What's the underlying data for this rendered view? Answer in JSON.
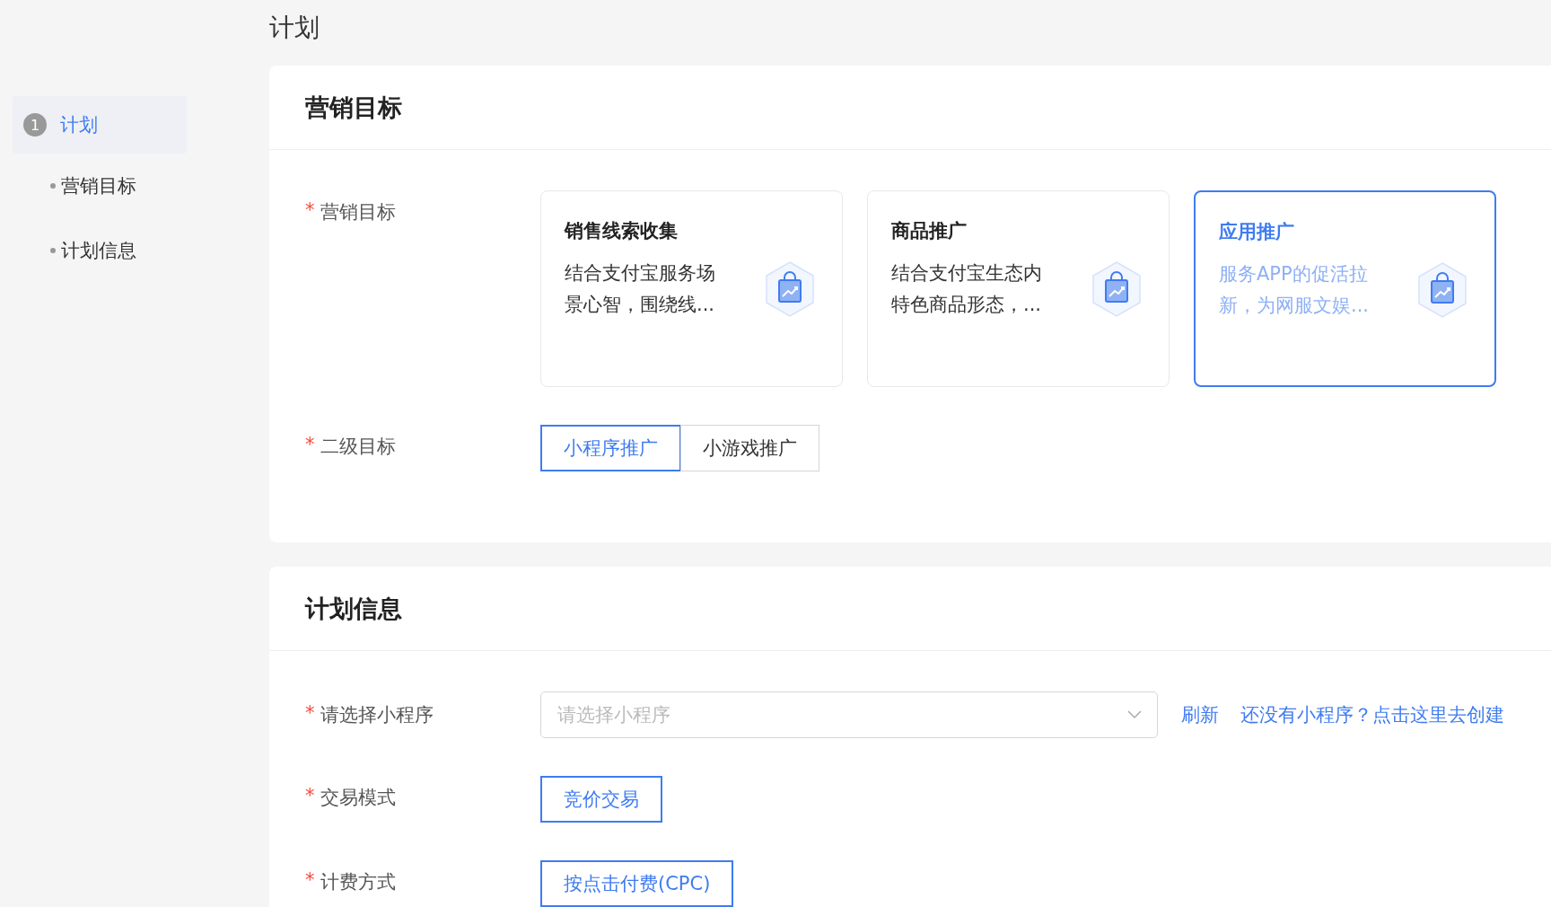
{
  "page_title": "计划",
  "sidebar": {
    "steps": [
      {
        "number": "1",
        "label": "计划",
        "selected": true,
        "children": [
          {
            "label": "营销目标"
          },
          {
            "label": "计划信息"
          }
        ]
      }
    ]
  },
  "sections": [
    {
      "title": "营销目标",
      "fields": [
        {
          "kind": "cards",
          "label": "营销目标",
          "required_mark": "*",
          "options": [
            {
              "title": "销售线索收集",
              "description": "结合支付宝服务场景心智，围绕线...",
              "selected": false
            },
            {
              "title": "商品推广",
              "description": "结合支付宝生态内特色商品形态，...",
              "selected": false
            },
            {
              "title": "应用推广",
              "description": "服务APP的促活拉新，为网服文娱...",
              "selected": true
            }
          ]
        },
        {
          "kind": "segments",
          "label": "二级目标",
          "required_mark": "*",
          "options": [
            {
              "label": "小程序推广",
              "selected": true
            },
            {
              "label": "小游戏推广",
              "selected": false
            }
          ]
        }
      ]
    },
    {
      "title": "计划信息",
      "fields": [
        {
          "kind": "select",
          "label": "请选择小程序",
          "required_mark": "*",
          "placeholder": "请选择小程序",
          "links": [
            "刷新",
            "还没有小程序？点击这里去创建"
          ]
        },
        {
          "kind": "segments",
          "label": "交易模式",
          "required_mark": "*",
          "options": [
            {
              "label": "竞价交易",
              "selected": true
            }
          ]
        },
        {
          "kind": "segments",
          "label": "计费方式",
          "required_mark": "*",
          "options": [
            {
              "label": "按点击付费(CPC)",
              "selected": true
            }
          ]
        }
      ]
    }
  ]
}
